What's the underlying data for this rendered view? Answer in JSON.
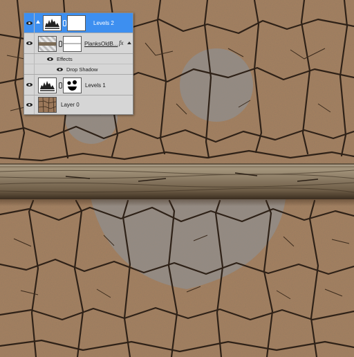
{
  "document": {
    "layers_panel": {
      "layers": [
        {
          "name": "Levels 2",
          "selected": true,
          "kind": "adjustment"
        },
        {
          "name": "PlanksOldB...",
          "selected": false,
          "kind": "smart",
          "fx_badge": "fx",
          "effects_label": "Effects",
          "effect_items": [
            "Drop Shadow"
          ]
        },
        {
          "name": "Levels 1",
          "selected": false,
          "kind": "adjustment"
        },
        {
          "name": "Layer 0",
          "selected": false,
          "kind": "pixel"
        }
      ]
    }
  },
  "icons": [
    "eye-icon",
    "levels-adjustment-icon",
    "layer-mask-thumbnail",
    "chain-link-icon",
    "smart-object-thumbnail",
    "fx-icon",
    "scroll-up-arrow-icon",
    "cracked-earth-thumbnail"
  ],
  "colors": {
    "ground": "#a7815f",
    "crack": "#2e2117",
    "gray_circle": "#8f8f8f",
    "plank": "#7c6b56",
    "selection_blue": "#3d8ff0",
    "panel_bg": "#d6d6d6"
  }
}
